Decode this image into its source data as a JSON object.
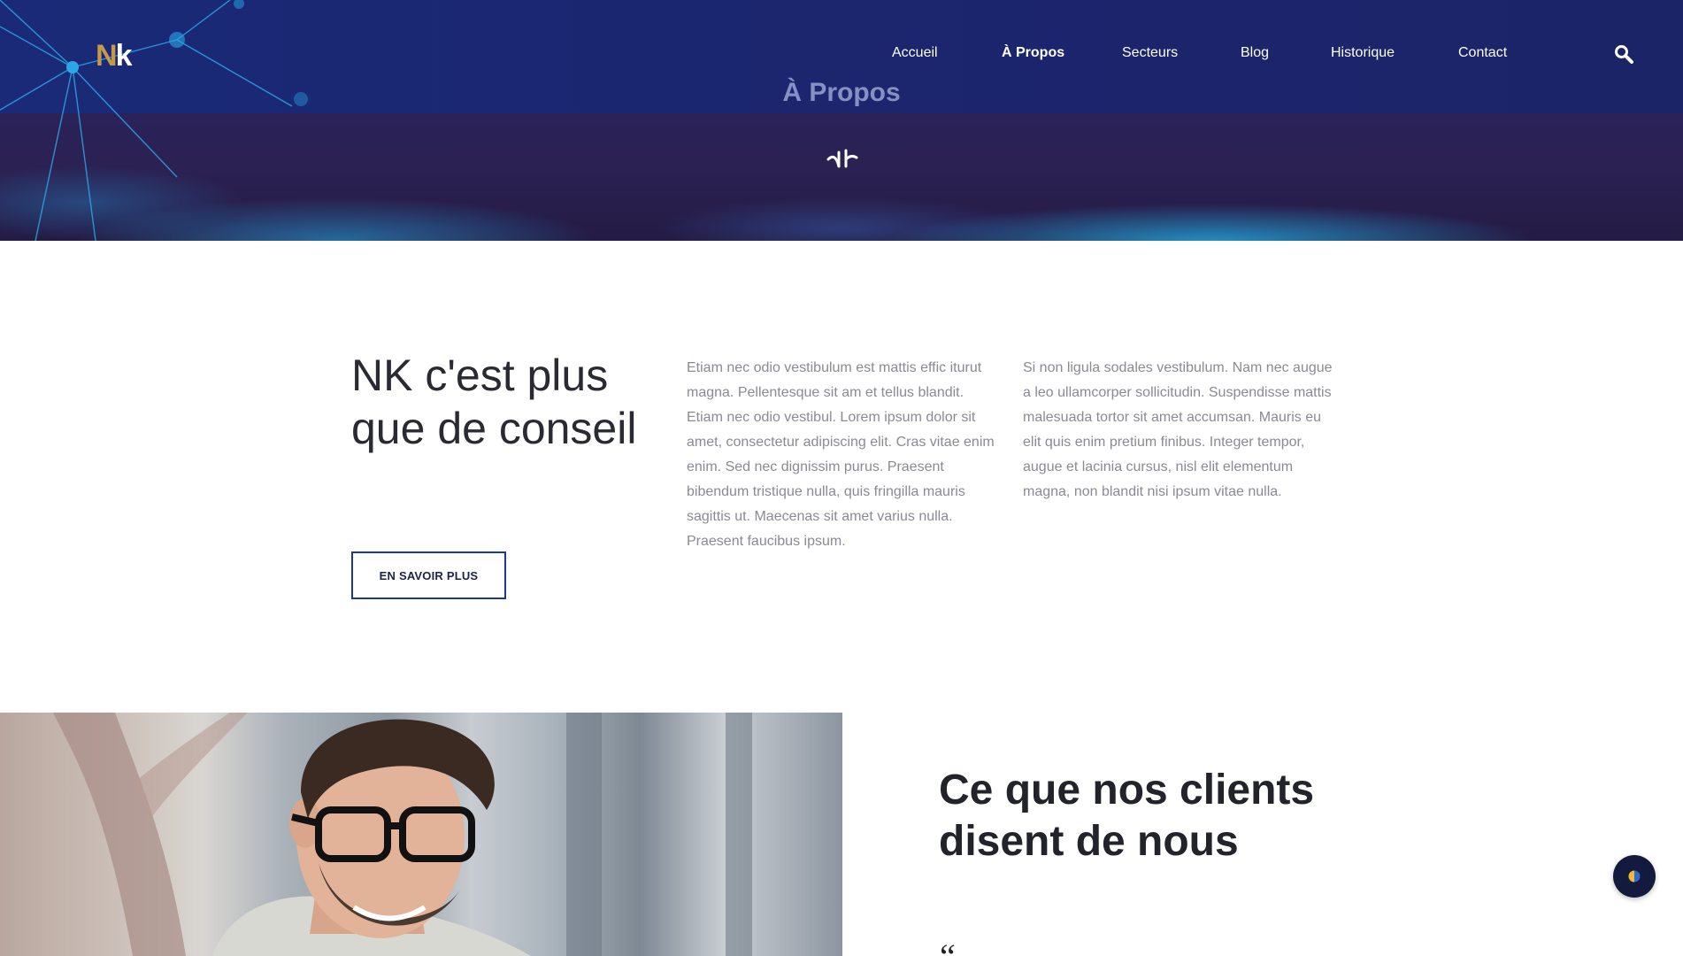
{
  "brand": {
    "logo_n": "N",
    "logo_k": "k",
    "accent_gold": "#c39a4a",
    "navy": "#1b2670"
  },
  "nav": {
    "items": [
      {
        "label": "Accueil",
        "active": false
      },
      {
        "label": "À Propos",
        "active": true
      },
      {
        "label": "Secteurs",
        "active": false
      },
      {
        "label": "Blog",
        "active": false
      },
      {
        "label": "Historique",
        "active": false
      },
      {
        "label": "Contact",
        "active": false
      }
    ],
    "search_icon": "search-icon"
  },
  "hero": {
    "title": "À Propos",
    "emblem_icon": "nk-emblem-icon"
  },
  "about": {
    "heading": "NK c'est plus que de conseil",
    "button_label": "EN SAVOIR PLUS",
    "col1": "Etiam nec odio vestibulum est mattis effic iturut magna. Pellentesque sit am et tellus blandit. Etiam nec odio vestibul. Lorem ipsum dolor sit amet, consectetur adipiscing elit. Cras vitae enim enim. Sed nec dignissim purus. Praesent bibendum tristique nulla, quis fringilla mauris sagittis ut. Maecenas sit amet varius nulla. Praesent faucibus ipsum.",
    "col2": "Si non ligula sodales vestibulum. Nam nec augue a leo ullamcorper sollicitudin. Suspendisse mattis malesuada tortor sit amet accumsan. Mauris eu elit quis enim pretium finibus. Integer tempor, augue et lacinia cursus, nisl elit elementum magna, non blandit nisi ipsum vitae nulla."
  },
  "testimonials": {
    "heading": "Ce que nos clients disent de nous",
    "quote_mark": "“"
  },
  "widgets": {
    "theme_toggle_icon": "contrast-icon"
  }
}
